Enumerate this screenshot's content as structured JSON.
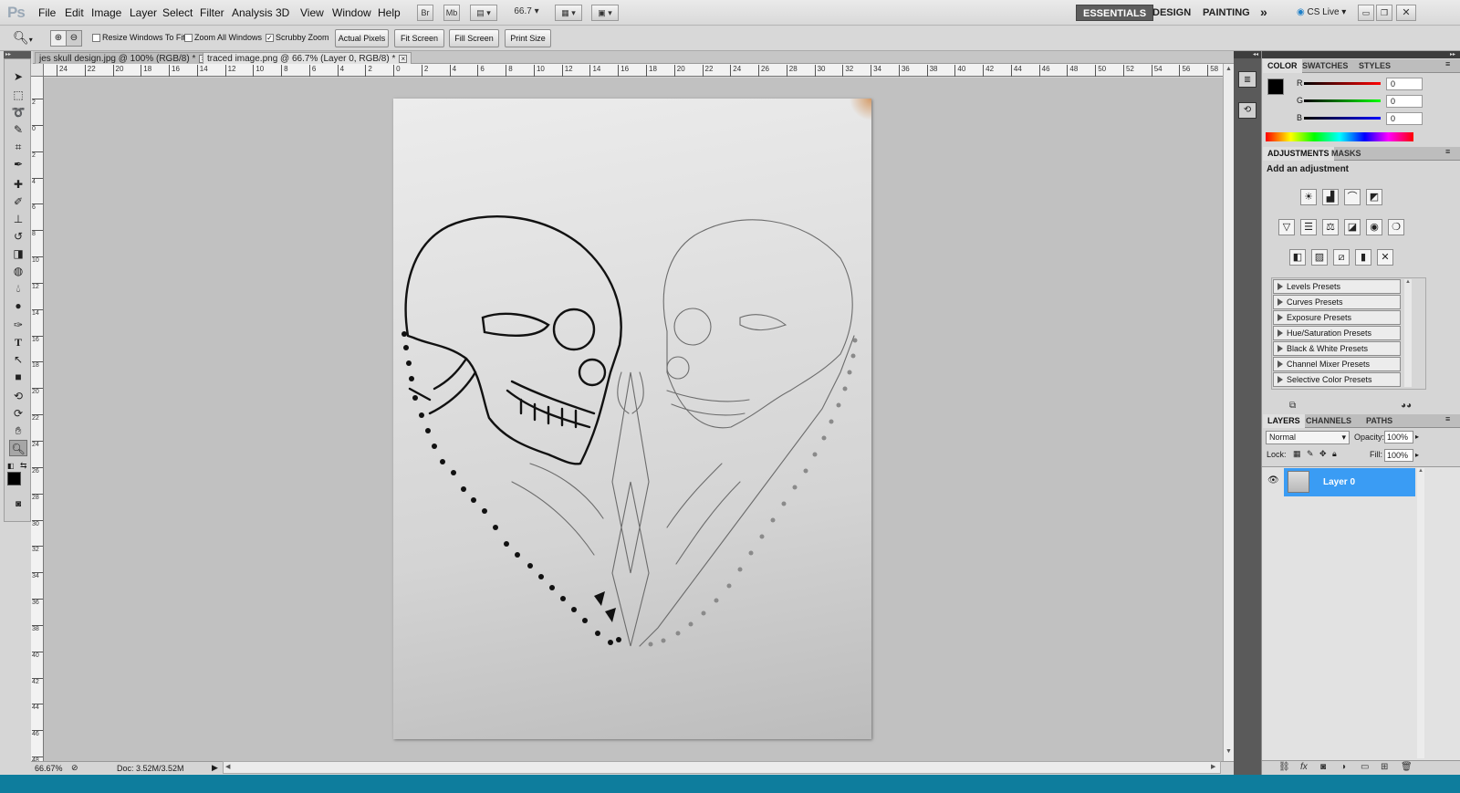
{
  "app": {
    "logo": "Ps"
  },
  "menubar": {
    "items": [
      "File",
      "Edit",
      "Image",
      "Layer",
      "Select",
      "Filter",
      "Analysis",
      "3D",
      "View",
      "Window",
      "Help"
    ],
    "bridge_label": "Br",
    "minibridge_label": "Mb",
    "zoom_value": "66.7",
    "workspaces": [
      "ESSENTIALS",
      "DESIGN",
      "PAINTING"
    ],
    "more_label": "»",
    "cslive_label": "CS Live"
  },
  "options": {
    "resize_windows": "Resize Windows To Fit",
    "zoom_all": "Zoom All Windows",
    "scrubby_zoom": "Scrubby Zoom",
    "actual_pixels": "Actual Pixels",
    "fit_screen": "Fit Screen",
    "fill_screen": "Fill Screen",
    "print_size": "Print Size"
  },
  "tabs": [
    {
      "label": "jes skull design.jpg @ 100% (RGB/8) *"
    },
    {
      "label": "traced image.png @ 66.7% (Layer 0, RGB/8) *"
    }
  ],
  "rulers": {
    "h_ticks": [
      "24",
      "22",
      "20",
      "18",
      "16",
      "14",
      "12",
      "10",
      "8",
      "6",
      "4",
      "2",
      "0",
      "2",
      "4",
      "6",
      "8",
      "10",
      "12",
      "14",
      "16",
      "18",
      "20",
      "22",
      "24",
      "26",
      "28",
      "30",
      "32",
      "34",
      "36",
      "38",
      "40",
      "42",
      "44",
      "46",
      "48",
      "50",
      "52",
      "54",
      "56",
      "58"
    ],
    "v_ticks": [
      "2",
      "0",
      "2",
      "4",
      "6",
      "8",
      "10",
      "12",
      "14",
      "16",
      "18",
      "20",
      "22",
      "24",
      "26",
      "28",
      "30",
      "32",
      "34",
      "36",
      "38",
      "40",
      "42",
      "44",
      "46",
      "48"
    ]
  },
  "status": {
    "zoom": "66.67%",
    "doc": "Doc: 3.52M/3.52M"
  },
  "color_panel": {
    "tabs": [
      "COLOR",
      "SWATCHES",
      "STYLES"
    ],
    "r_label": "R",
    "g_label": "G",
    "b_label": "B",
    "r_value": "0",
    "g_value": "0",
    "b_value": "0",
    "foreground": "#000000",
    "background": "#ffffff"
  },
  "adjustments_panel": {
    "tabs": [
      "ADJUSTMENTS",
      "MASKS"
    ],
    "heading": "Add an adjustment",
    "presets": [
      "Levels Presets",
      "Curves Presets",
      "Exposure Presets",
      "Hue/Saturation Presets",
      "Black & White Presets",
      "Channel Mixer Presets",
      "Selective Color Presets"
    ]
  },
  "layers_panel": {
    "tabs": [
      "LAYERS",
      "CHANNELS",
      "PATHS"
    ],
    "blend_mode": "Normal",
    "opacity_label": "Opacity:",
    "opacity_value": "100%",
    "lock_label": "Lock:",
    "fill_label": "Fill:",
    "fill_value": "100%",
    "layers": [
      {
        "name": "Layer 0"
      }
    ]
  },
  "colors": {
    "accent": "#3a9cf4",
    "icon_strip": "#5a5a5a"
  }
}
